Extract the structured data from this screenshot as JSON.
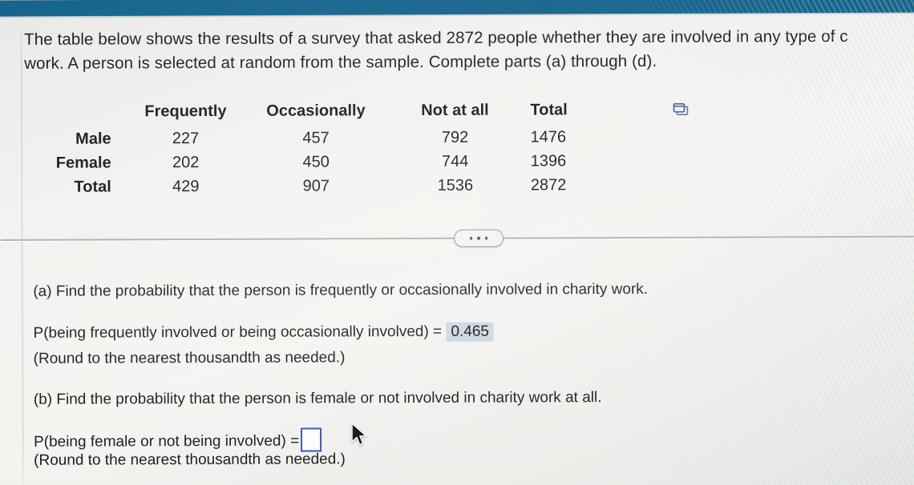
{
  "app": {
    "topbar_color": "#14638c",
    "background_color": "#f1f1ef"
  },
  "prompt": {
    "line1": "The table below shows the results of a survey that asked 2872 people whether they are involved in any type of c",
    "line2": "work. A person is selected at random from the sample. Complete parts (a) through (d)."
  },
  "table": {
    "corner": "",
    "columns": [
      "Frequently",
      "Occasionally",
      "Not at all",
      "Total"
    ],
    "rows": [
      {
        "label": "Male",
        "cells": [
          "227",
          "457",
          "792",
          "1476"
        ]
      },
      {
        "label": "Female",
        "cells": [
          "202",
          "450",
          "744",
          "1396"
        ]
      },
      {
        "label": "Total",
        "cells": [
          "429",
          "907",
          "1536",
          "2872"
        ]
      }
    ],
    "copy_icon": "copy-windows-icon"
  },
  "divider": {
    "dots_label": "more-options",
    "dot_count": 3
  },
  "parts": {
    "a": {
      "question": "(a) Find the probability that the person is frequently or occasionally involved in charity work.",
      "answer_label": "P(being frequently involved or being occasionally involved) =",
      "answer_value": "0.465",
      "answer_highlight_color": "#ccd5e1",
      "note": "(Round to the nearest thousandth as needed.)"
    },
    "b": {
      "question": "(b) Find the probability that the person is female or not involved in charity work at all.",
      "answer_label": "P(being female or not being involved) =",
      "answer_value": "",
      "answer_placeholder": "",
      "input_border_color": "#3b4fbe",
      "note": "(Round to the nearest thousandth as needed.)"
    }
  },
  "cursor": {
    "type": "arrow-pointer"
  }
}
